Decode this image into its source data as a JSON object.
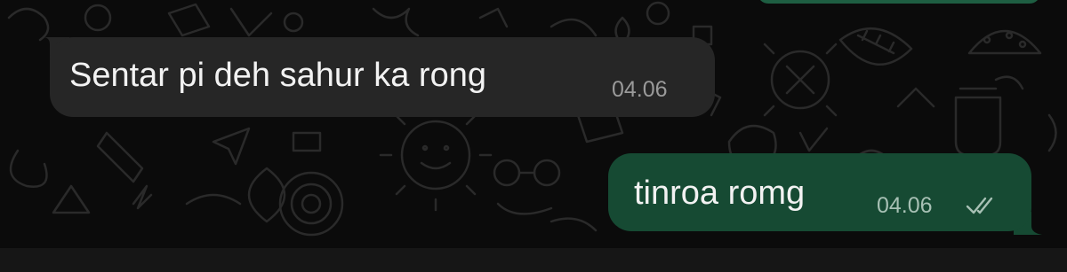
{
  "messages": [
    {
      "direction": "incoming",
      "text": "Sentar pi deh sahur ka rong",
      "time": "04.06"
    },
    {
      "direction": "outgoing",
      "text": "tinroa romg",
      "time": "04.06",
      "status_icon": "double-check-icon"
    }
  ],
  "colors": {
    "background": "#0b0b0b",
    "incoming_bubble": "#262626",
    "outgoing_bubble": "#164a33",
    "text": "#f2f2f2",
    "incoming_time": "#9a9a9a",
    "outgoing_time": "#a7c0b4"
  }
}
